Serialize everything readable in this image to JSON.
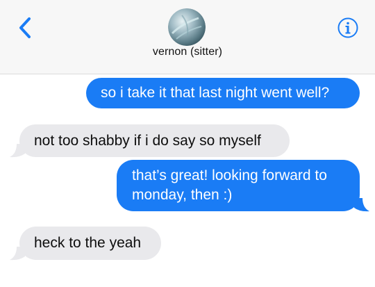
{
  "header": {
    "contact_name": "vernon (sitter)",
    "back_icon": "chevron-left-icon",
    "info_icon": "info-icon"
  },
  "colors": {
    "sent_bubble": "#1a7cf5",
    "received_bubble": "#e9e9ec",
    "accent": "#1a7cf5",
    "header_bg": "#f7f7f7"
  },
  "messages": [
    {
      "direction": "sent",
      "text": "so i take it that last night went well?"
    },
    {
      "direction": "received",
      "text": "not too shabby if i do say so myself"
    },
    {
      "direction": "sent",
      "text": "that’s great! looking forward to monday, then :)"
    },
    {
      "direction": "received",
      "text": "heck to the yeah"
    }
  ]
}
